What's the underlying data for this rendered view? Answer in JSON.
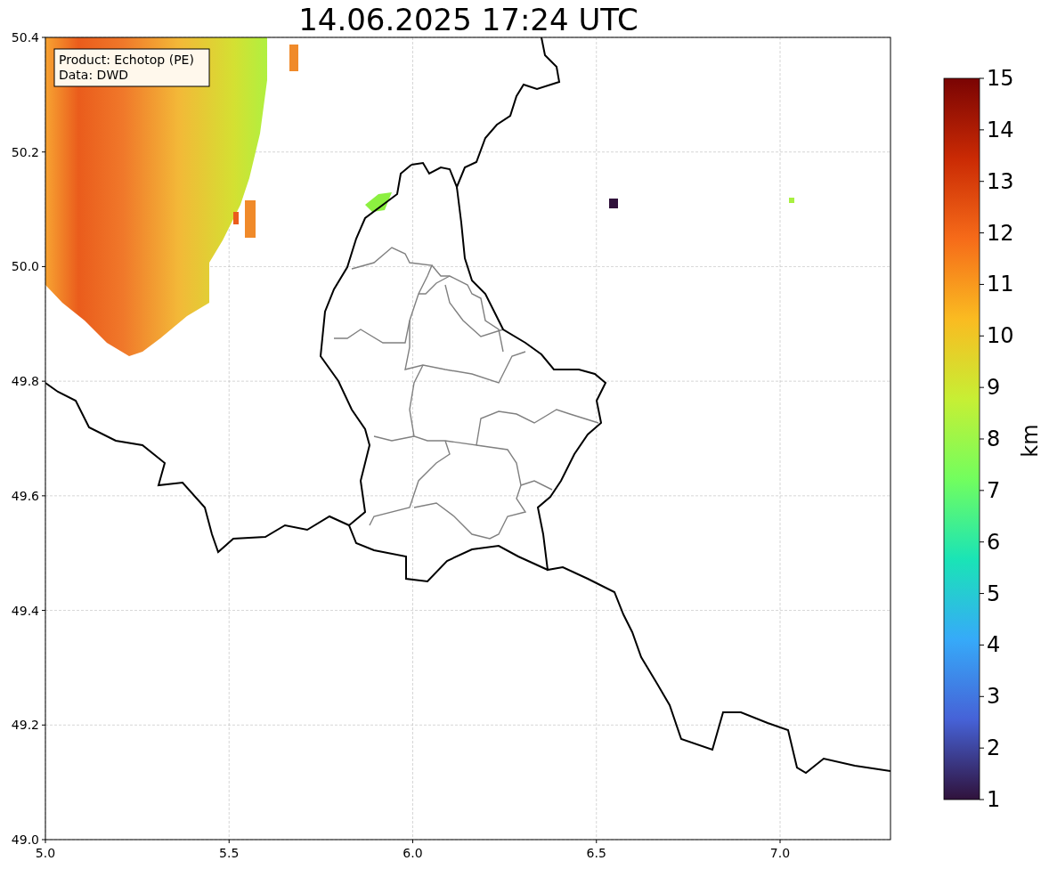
{
  "title": "14.06.2025 17:24 UTC",
  "legend": {
    "lines": [
      "Product: Echotop (PE)",
      "Data: DWD"
    ]
  },
  "y_ticks": [
    "50.4",
    "50.2",
    "50.0",
    "49.8",
    "49.6",
    "49.4",
    "49.2",
    "49.0"
  ],
  "x_ticks": [
    "5.0",
    "5.5",
    "6.0",
    "6.5",
    "7.0"
  ],
  "colorbar": {
    "label": "km",
    "ticks": [
      "15",
      "14",
      "13",
      "12",
      "11",
      "10",
      "9",
      "8",
      "7",
      "6",
      "5",
      "4",
      "3",
      "2",
      "1"
    ]
  }
}
